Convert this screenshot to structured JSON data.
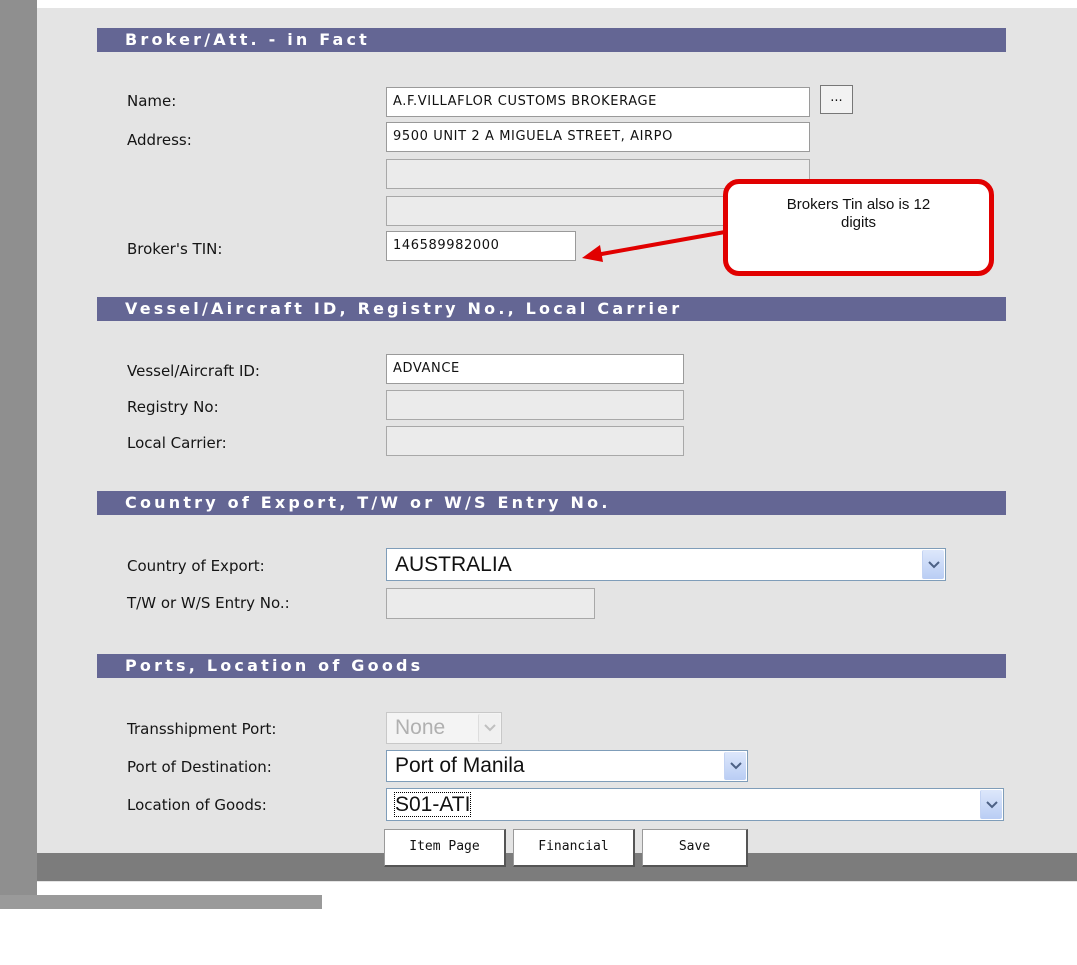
{
  "sections": {
    "broker": "Broker/Att. - in Fact",
    "vessel": "Vessel/Aircraft ID, Registry No., Local Carrier",
    "country": "Country of Export, T/W or W/S Entry No.",
    "ports": "Ports, Location of Goods"
  },
  "broker": {
    "name_label": "Name:",
    "name_value": "A.F.VILLAFLOR CUSTOMS BROKERAGE",
    "lookup_label": "...",
    "address_label": "Address:",
    "address_line1": "9500 UNIT 2 A MIGUELA STREET, AIRPO",
    "address_line2": "",
    "address_line3": "",
    "tin_label": "Broker's TIN:",
    "tin_value": "146589982000"
  },
  "callout": {
    "text": "Brokers Tin also is 12 digits",
    "border_color": "#e10000"
  },
  "vessel": {
    "id_label": "Vessel/Aircraft ID:",
    "id_value": "ADVANCE",
    "registry_label": "Registry No:",
    "registry_value": "",
    "carrier_label": "Local Carrier:",
    "carrier_value": ""
  },
  "country": {
    "export_label": "Country of Export:",
    "export_value": "AUSTRALIA",
    "entry_label": "T/W or W/S Entry No.:",
    "entry_value": ""
  },
  "ports": {
    "transship_label": "Transshipment Port:",
    "transship_value": "None",
    "destination_label": "Port of Destination:",
    "destination_value": "Port of Manila",
    "location_label": "Location of Goods:",
    "location_value": "S01-ATI"
  },
  "footer": {
    "item_page": "Item Page",
    "financial": "Financial",
    "save": "Save"
  },
  "colors": {
    "section_header": "#646694",
    "panel": "#e4e4e4",
    "footer_bar": "#7c7c7c"
  }
}
